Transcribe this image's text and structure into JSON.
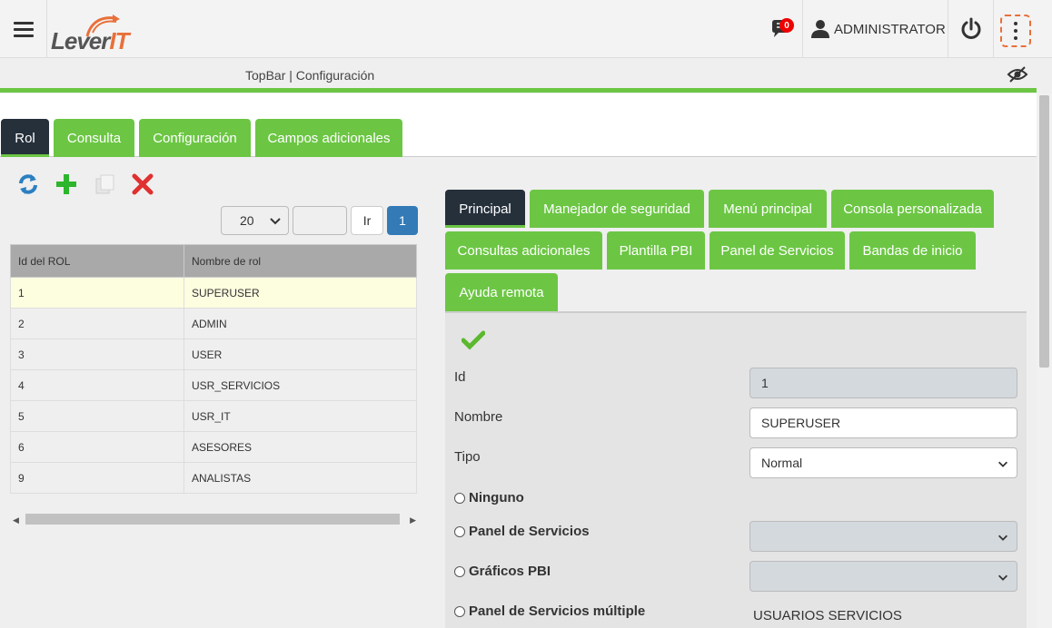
{
  "header": {
    "logo_text": "Lever",
    "logo_suffix": "IT",
    "notification_count": "0",
    "user_name": "ADMINISTRATOR"
  },
  "breadcrumb": "TopBar | Configuración",
  "main_tabs": [
    "Rol",
    "Consulta",
    "Configuración",
    "Campos adicionales"
  ],
  "pager": {
    "page_size": "20",
    "go_label": "Ir",
    "current_page": "1"
  },
  "grid": {
    "columns": [
      "Id del ROL",
      "Nombre de rol"
    ],
    "rows": [
      [
        "1",
        "SUPERUSER"
      ],
      [
        "2",
        "ADMIN"
      ],
      [
        "3",
        "USER"
      ],
      [
        "4",
        "USR_SERVICIOS"
      ],
      [
        "5",
        "USR_IT"
      ],
      [
        "6",
        "ASESORES"
      ],
      [
        "9",
        "ANALISTAS"
      ]
    ]
  },
  "sub_tabs": [
    "Principal",
    "Manejador de seguridad",
    "Menú principal",
    "Consola personalizada",
    "Consultas adicionales",
    "Plantilla PBI",
    "Panel de Servicios",
    "Bandas de inicio",
    "Ayuda remota"
  ],
  "form": {
    "id_label": "Id",
    "id_value": "1",
    "name_label": "Nombre",
    "name_value": "SUPERUSER",
    "type_label": "Tipo",
    "type_value": "Normal",
    "radio_none": "Ninguno",
    "radio_panel": "Panel de Servicios",
    "radio_pbi": "Gráficos PBI",
    "radio_multi": "Panel de Servicios múltiple",
    "multi_value": "USUARIOS SERVICIOS"
  },
  "colors": {
    "accent_green": "#6cc644",
    "dark_tab": "#25303b",
    "primary_blue": "#337ab7",
    "logo_orange": "#e8703a"
  }
}
